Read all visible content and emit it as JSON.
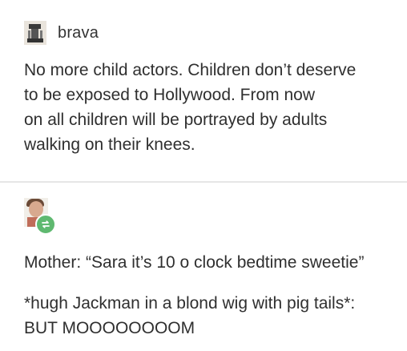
{
  "post1": {
    "username": "brava",
    "lines": [
      "No more child actors. Children don’t deserve",
      "to be exposed to Hollywood. From now",
      "on all children will be portrayed by adults",
      "walking on their knees."
    ]
  },
  "post2": {
    "paragraph1": "Mother: “Sara it’s 10 o clock bedtime sweetie”",
    "paragraph2_lines": [
      "*hugh Jackman in a blond wig with pig tails*:",
      "BUT MOOOOOOOOM"
    ]
  },
  "icons": {
    "avatar1": "avatar-sketch-icon",
    "avatar2": "avatar-photo-icon",
    "reblog": "reblog-icon"
  },
  "colors": {
    "reblog_badge": "#5fb970",
    "divider": "#e6e6e6",
    "text": "#2f2f2f"
  }
}
